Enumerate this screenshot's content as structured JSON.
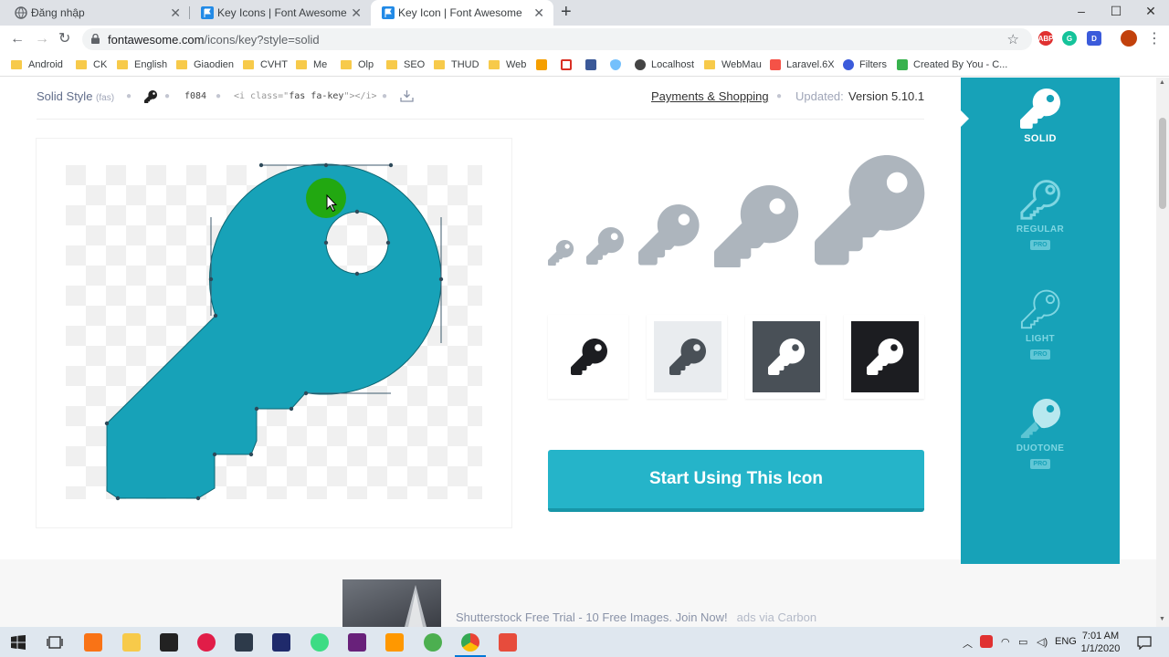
{
  "browser": {
    "tabs": [
      {
        "title": "Đăng nhập",
        "active": false
      },
      {
        "title": "Key Icons | Font Awesome",
        "active": false
      },
      {
        "title": "Key Icon | Font Awesome",
        "active": true
      }
    ],
    "url_host": "fontawesome.com",
    "url_path": "/icons/key?style=solid",
    "new_tab_symbol": "+",
    "extensions": [
      "ABP",
      "G",
      "D"
    ]
  },
  "bookmarks": [
    {
      "label": "Android",
      "icon": "folder-icon"
    },
    {
      "label": "CK",
      "icon": "folder-icon"
    },
    {
      "label": "English",
      "icon": "folder-icon"
    },
    {
      "label": "Giaodien",
      "icon": "folder-icon"
    },
    {
      "label": "CVHT",
      "icon": "folder-icon"
    },
    {
      "label": "Me",
      "icon": "folder-icon"
    },
    {
      "label": "Olp",
      "icon": "folder-icon"
    },
    {
      "label": "SEO",
      "icon": "folder-icon"
    },
    {
      "label": "THUD",
      "icon": "folder-icon"
    },
    {
      "label": "Web",
      "icon": "folder-icon"
    },
    {
      "label": "",
      "icon": "pma-icon"
    },
    {
      "label": "",
      "icon": "gmail-icon"
    },
    {
      "label": "",
      "icon": "facebook-icon"
    },
    {
      "label": "",
      "icon": "shield-icon"
    },
    {
      "label": "Localhost",
      "icon": "globe-icon"
    },
    {
      "label": "WebMau",
      "icon": "folder-icon"
    },
    {
      "label": "Laravel.6X",
      "icon": "laravel-icon"
    },
    {
      "label": "Filters",
      "icon": "filter-icon"
    },
    {
      "label": "Created By You - C...",
      "icon": "created-icon"
    }
  ],
  "meta": {
    "style_name": "Solid Style",
    "style_prefix": "(fas)",
    "unicode": "f084",
    "code_open": "<i class=\"",
    "code_class": "fas fa-key",
    "code_close": "\"></i>",
    "category": "Payments & Shopping",
    "updated_label": "Updated:",
    "version": "Version 5.10.1"
  },
  "cta_label": "Start Using This Icon",
  "styles": [
    {
      "label": "SOLID",
      "pro": false,
      "active": true
    },
    {
      "label": "REGULAR",
      "pro": true,
      "active": false
    },
    {
      "label": "LIGHT",
      "pro": true,
      "active": false
    },
    {
      "label": "DUOTONE",
      "pro": true,
      "active": false
    }
  ],
  "pro_badge": "PRO",
  "ad": {
    "text": "Shutterstock Free Trial - 10 Free Images. Join Now!",
    "via": "ads via Carbon"
  },
  "taskbar": {
    "time": "7:01 AM",
    "date": "1/1/2020",
    "lang": "ENG"
  },
  "colors": {
    "accent": "#17a2b8",
    "cta": "#25b4c9",
    "key_canvas": "#17a2b8",
    "key_gray": "#adb5bd",
    "cursor_dot": "#22a811"
  }
}
